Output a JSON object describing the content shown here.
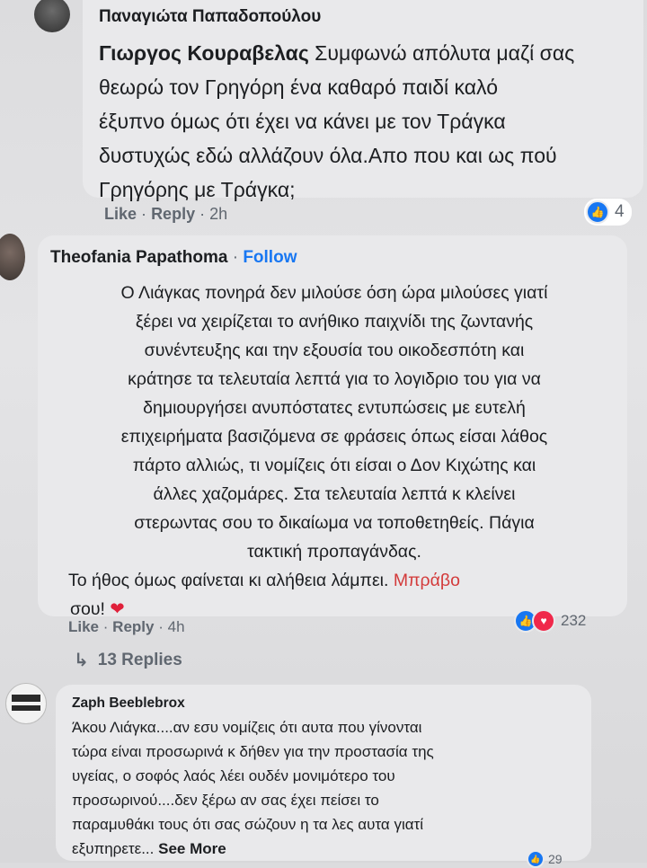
{
  "comment1": {
    "author": "Παναγιώτα Παπαδοπούλου",
    "mention": "Γιωργος Κουραβελας",
    "lines": [
      " Συμφωνώ απόλυτα μαζί σας",
      "θεωρώ τον Γρηγόρη ένα καθαρό παιδί καλό",
      "έξυπνο όμως ότι έχει να κάνει με τον Τράγκα",
      "δυστυχώς εδώ αλλάζουν όλα.Απο που και ως πού",
      "Γρηγόρης με Τράγκα;"
    ],
    "like": "Like",
    "reply": "Reply",
    "sep": "·",
    "time": "2h",
    "reaction_count": "4"
  },
  "comment2": {
    "author": "Theofania Papathoma",
    "follow_sep": "·",
    "follow": "Follow",
    "lines": [
      "Ο Λιάγκας πονηρά δεν μιλούσε όση ώρα μιλούσες γιατί",
      "ξέρει να χειρίζεται το ανήθικο παιχνίδι της ζωντανής",
      "συνέντευξης και την εξουσία του οικοδεσπότη και",
      "κράτησε τα τελευταία λεπτά για το λογιδριο του για να",
      "δημιουργήσει ανυπόστατες εντυπώσεις με ευτελή",
      "επιχειρήματα βασιζόμενα σε φράσεις όπως είσαι λάθος",
      "πάρτο αλλιώς, τι νομίζεις ότι είσαι ο Δον Κιχώτης και",
      "άλλες χαζομάρες. Στα τελευταία λεπτά κ κλείνει",
      "στερωντας σου το δικαίωμα να τοποθετηθείς. Πάγια",
      "τακτική προπαγάνδας."
    ],
    "line11_start": "Το ήθος όμως φαίνεται κι αλήθεια λάμπει. ",
    "line11_red": "Μπράβο",
    "line12": "σου! ",
    "like": "Like",
    "reply": "Reply",
    "sep": "·",
    "time": "4h",
    "reaction_count": "232",
    "replies_label": "13 Replies"
  },
  "comment3": {
    "author": "Zaph Beeblebrox",
    "lines": [
      "Άκου Λιάγκα....αν εσυ νομίζεις ότι αυτα που γίνονται",
      "τώρα είναι προσωρινά κ δήθεν για την προστασία της",
      "υγείας, ο σοφός λαός λέει ουδέν μονιμότερο του",
      "προσωρινού....δεν ξέρω αν σας έχει πείσει το",
      "παραμυθάκι τους ότι σας σώζουν η τα λες αυτα γιατί"
    ],
    "last_line": "εξυπηρετε... ",
    "see_more": "See More",
    "reaction_count": "29"
  },
  "colors": {
    "bubble": "#e9e9eb",
    "link_blue": "#1877f2",
    "meta_gray": "#606770",
    "red": "#d33a3a"
  }
}
